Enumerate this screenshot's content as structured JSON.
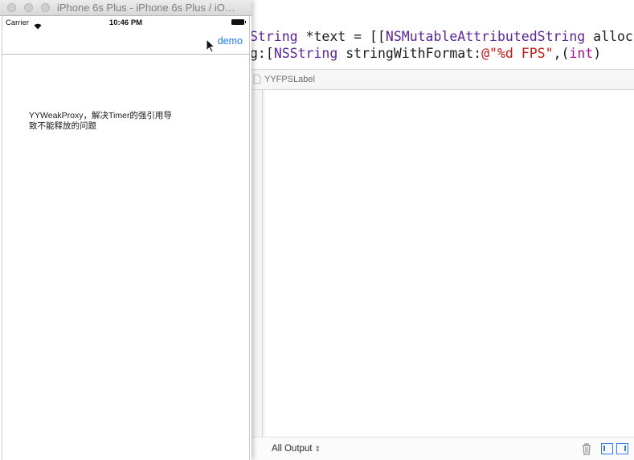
{
  "simulator": {
    "window_title": "iPhone 6s Plus - iPhone 6s Plus / iO…",
    "status_bar": {
      "carrier": "Carrier",
      "time": "10:46 PM"
    },
    "nav_bar": {
      "right_button": "demo"
    },
    "list": [
      {
        "title": "YYWeakProxy，解决Timer的强引用导致不能释放的问题"
      }
    ]
  },
  "xcode": {
    "code_lines": [
      {
        "tokens": [
          {
            "text": "String ",
            "kind": "type"
          },
          {
            "text": "*text = [[",
            "kind": "plain"
          },
          {
            "text": "NSMutableAttributedString",
            "kind": "type"
          },
          {
            "text": " alloc",
            "kind": "plain"
          }
        ]
      },
      {
        "tokens": [
          {
            "text": "g:[",
            "kind": "plain"
          },
          {
            "text": "NSString",
            "kind": "type"
          },
          {
            "text": " stringWithFormat:",
            "kind": "plain"
          },
          {
            "text": "@\"%d FPS\"",
            "kind": "string"
          },
          {
            "text": ",(",
            "kind": "plain"
          },
          {
            "text": "int",
            "kind": "keyword"
          },
          {
            "text": ")",
            "kind": "plain"
          }
        ]
      }
    ],
    "jump_bar": {
      "label": "YYFPSLabel"
    },
    "debug": {
      "output_selector": "All Output"
    }
  },
  "icons": {
    "wifi": "wifi-icon",
    "battery": "battery-icon",
    "cursor": "mouse-pointer-icon",
    "trash": "trash-icon",
    "jump_bar_file": "file-icon",
    "split_left": "left-panel-icon",
    "split_right": "right-panel-icon"
  },
  "colors": {
    "ios_tint": "#1d7bf6",
    "code_type": "#5b2699",
    "code_string": "#c41a16",
    "code_keyword": "#aa0d91",
    "xcode_accent": "#2f7cf6"
  }
}
